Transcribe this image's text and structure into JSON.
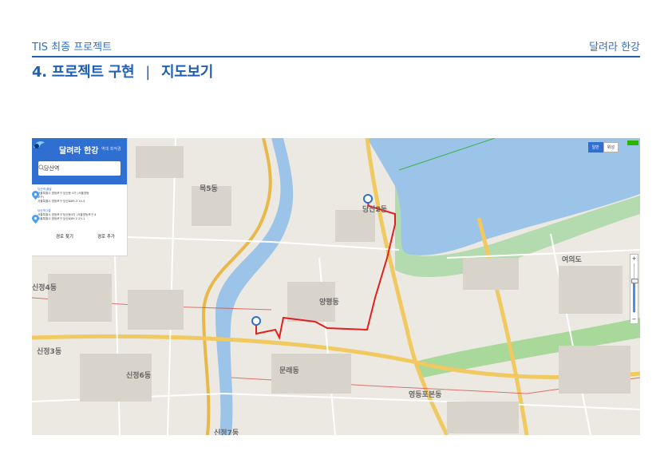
{
  "header": {
    "left": "TIS 최종 프로젝트",
    "right": "달려라 한강"
  },
  "title": {
    "section": "4. 프로젝트 구현",
    "separator": "|",
    "sub": "지도보기"
  },
  "app": {
    "brand": "달려라 한강",
    "brand_sub": "역대 최적경",
    "search_value": "당산역",
    "entries": [
      {
        "label": "당산역 출발",
        "lines": [
          "서울특별시 영등포구 당산동 4가 (서울영등",
          "포구)",
          "서울특별시 영등포구 당산로89-3 14-4"
        ]
      },
      {
        "label": "당산역 2출",
        "lines": [
          "서울특별시 영등포구 당산동3가 (서울영등포구 4",
          "서울특별시 영등포구 당산로89 2 23-1"
        ]
      }
    ],
    "button_route": "경로 찾기",
    "button_add": "경로 추가"
  },
  "map": {
    "toggle": [
      "일반",
      "위성"
    ],
    "zoom_level_fraction": 0.6,
    "accent_color": "#2f6fd1",
    "route_color": "#e02020",
    "labels": [
      "당산2동",
      "문래동",
      "영등포본동",
      "신정7동",
      "신정4동",
      "신정6동",
      "양평동",
      "목5동",
      "여의도",
      "신정3동"
    ]
  }
}
